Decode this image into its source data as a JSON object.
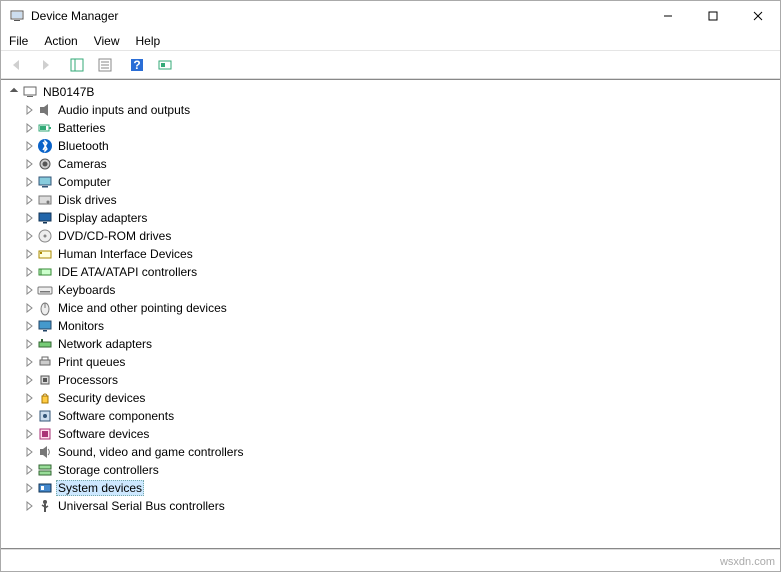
{
  "window": {
    "title": "Device Manager"
  },
  "menu": {
    "file": "File",
    "action": "Action",
    "view": "View",
    "help": "Help"
  },
  "root": {
    "label": "NB0147B"
  },
  "categories": [
    {
      "label": "Audio inputs and outputs",
      "icon": "audio",
      "selected": false
    },
    {
      "label": "Batteries",
      "icon": "battery",
      "selected": false
    },
    {
      "label": "Bluetooth",
      "icon": "bt",
      "selected": false
    },
    {
      "label": "Cameras",
      "icon": "camera",
      "selected": false
    },
    {
      "label": "Computer",
      "icon": "pc",
      "selected": false
    },
    {
      "label": "Disk drives",
      "icon": "disk",
      "selected": false
    },
    {
      "label": "Display adapters",
      "icon": "display",
      "selected": false
    },
    {
      "label": "DVD/CD-ROM drives",
      "icon": "dvd",
      "selected": false
    },
    {
      "label": "Human Interface Devices",
      "icon": "hid",
      "selected": false
    },
    {
      "label": "IDE ATA/ATAPI controllers",
      "icon": "ide",
      "selected": false
    },
    {
      "label": "Keyboards",
      "icon": "kbd",
      "selected": false
    },
    {
      "label": "Mice and other pointing devices",
      "icon": "mouse",
      "selected": false
    },
    {
      "label": "Monitors",
      "icon": "monitor",
      "selected": false
    },
    {
      "label": "Network adapters",
      "icon": "net",
      "selected": false
    },
    {
      "label": "Print queues",
      "icon": "printer",
      "selected": false
    },
    {
      "label": "Processors",
      "icon": "cpu",
      "selected": false
    },
    {
      "label": "Security devices",
      "icon": "security",
      "selected": false
    },
    {
      "label": "Software components",
      "icon": "swc",
      "selected": false
    },
    {
      "label": "Software devices",
      "icon": "swd",
      "selected": false
    },
    {
      "label": "Sound, video and game controllers",
      "icon": "sound",
      "selected": false
    },
    {
      "label": "Storage controllers",
      "icon": "storage",
      "selected": false
    },
    {
      "label": "System devices",
      "icon": "system",
      "selected": true
    },
    {
      "label": "Universal Serial Bus controllers",
      "icon": "usb",
      "selected": false
    }
  ],
  "watermark": "wsxdn.com"
}
